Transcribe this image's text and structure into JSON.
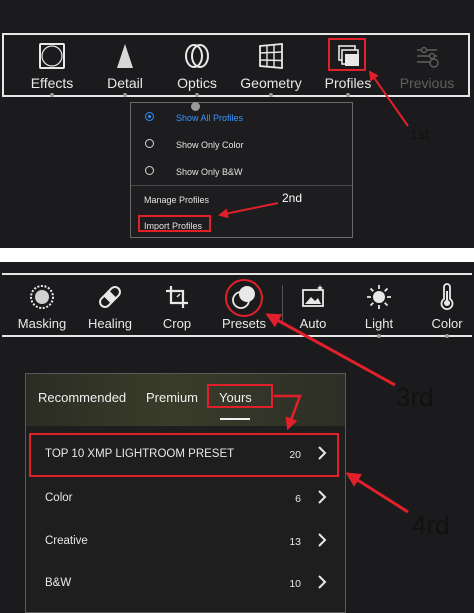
{
  "colors": {
    "accent_red": "#e0202a",
    "selected_blue": "#3b95ff",
    "panel_bg": "#1b1b1d"
  },
  "toolbar_top": {
    "items": [
      {
        "label": "Effects",
        "icon": "vignette-square-icon"
      },
      {
        "label": "Detail",
        "icon": "detail-triangle-icon"
      },
      {
        "label": "Optics",
        "icon": "lens-icon"
      },
      {
        "label": "Geometry",
        "icon": "geometry-grid-icon"
      },
      {
        "label": "Profiles",
        "icon": "profiles-stack-icon"
      },
      {
        "label": "Previous",
        "icon": "previous-sliders-icon"
      }
    ]
  },
  "profile_menu": {
    "options": [
      {
        "label": "Show All Profiles",
        "selected": true
      },
      {
        "label": "Show Only Color",
        "selected": false
      },
      {
        "label": "Show Only B&W",
        "selected": false
      }
    ],
    "manage_label": "Manage Profiles",
    "import_label": "Import Profiles"
  },
  "toolbar_bottom": {
    "items": [
      {
        "label": "Masking",
        "icon": "masking-icon"
      },
      {
        "label": "Healing",
        "icon": "bandage-icon"
      },
      {
        "label": "Crop",
        "icon": "crop-icon"
      },
      {
        "label": "Presets",
        "icon": "presets-icon"
      },
      {
        "label": "Auto",
        "icon": "auto-image-icon"
      },
      {
        "label": "Light",
        "icon": "sun-icon"
      },
      {
        "label": "Color",
        "icon": "thermometer-icon"
      }
    ]
  },
  "presets_panel": {
    "tabs": [
      "Recommended",
      "Premium",
      "Yours"
    ],
    "active_tab": "Yours",
    "groups": [
      {
        "name": "TOP 10 XMP LIGHTROOM  PRESET",
        "count": "20"
      },
      {
        "name": "Color",
        "count": "6"
      },
      {
        "name": "Creative",
        "count": "13"
      },
      {
        "name": "B&W",
        "count": "10"
      }
    ]
  },
  "annotations": {
    "step1": "1st",
    "step2": "2nd",
    "step3": "3rd",
    "step4": "4rd"
  }
}
